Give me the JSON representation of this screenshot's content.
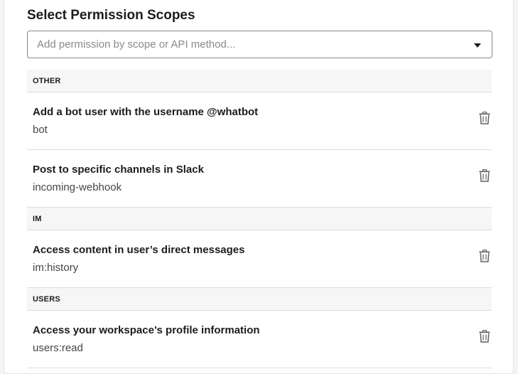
{
  "header": {
    "title": "Select Permission Scopes"
  },
  "search": {
    "placeholder": "Add permission by scope or API method..."
  },
  "icons": {
    "dropdown": "caret-down-icon",
    "delete": "trash-icon"
  },
  "groups": [
    {
      "label": "OTHER",
      "scopes": [
        {
          "description": "Add a bot user with the username @whatbot",
          "name": "bot"
        },
        {
          "description": "Post to specific channels in Slack",
          "name": "incoming-webhook"
        }
      ]
    },
    {
      "label": "IM",
      "scopes": [
        {
          "description": "Access content in user’s direct messages",
          "name": "im:history"
        }
      ]
    },
    {
      "label": "USERS",
      "scopes": [
        {
          "description": "Access your workspace’s profile information",
          "name": "users:read"
        }
      ]
    }
  ],
  "colors": {
    "text": "#1d1c1d",
    "subtext": "#454545",
    "header_bg": "#f6f6f6",
    "border": "#dddddd",
    "icon": "#616061"
  }
}
